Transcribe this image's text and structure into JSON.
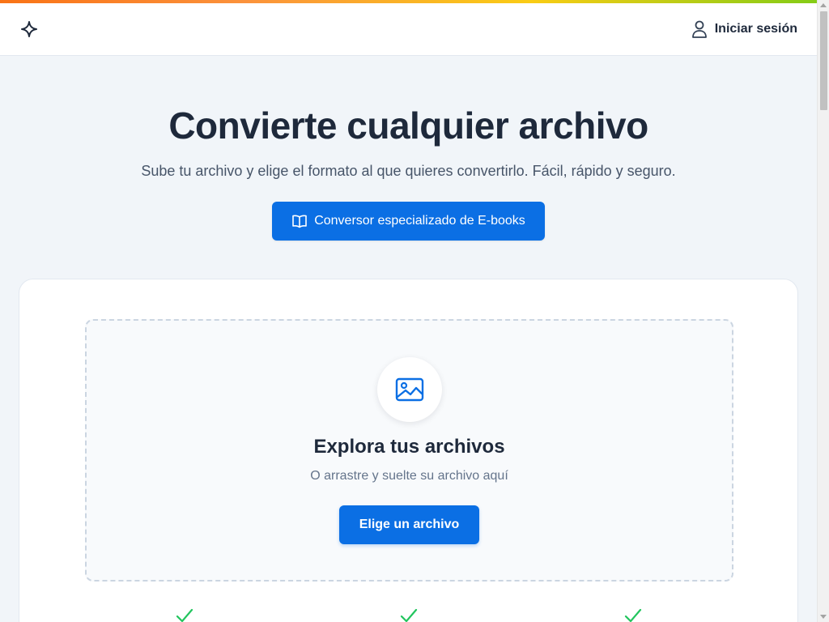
{
  "colors": {
    "accent": "#0b6fe4",
    "page_background": "#f1f5f9",
    "heading": "#1e293b",
    "check": "#22c55e",
    "stripe": [
      "#f97316",
      "#facc15",
      "#84cc16"
    ]
  },
  "header": {
    "logo_icon": "sparkle-icon",
    "login": {
      "icon": "user-icon",
      "label": "Iniciar sesión"
    }
  },
  "hero": {
    "title": "Convierte cualquier archivo",
    "subtitle": "Sube tu archivo y elige el formato al que quieres convertirlo. Fácil, rápido y seguro.",
    "ebook_button": {
      "icon": "book-open-icon",
      "label": "Conversor especializado de E-books"
    }
  },
  "upload": {
    "icon": "image-icon",
    "title": "Explora tus archivos",
    "subtitle": "O arrastre y suelte su archivo aquí",
    "button_label": "Elige un archivo"
  },
  "features": [
    {
      "icon": "check-icon"
    },
    {
      "icon": "check-icon"
    },
    {
      "icon": "check-icon"
    }
  ]
}
